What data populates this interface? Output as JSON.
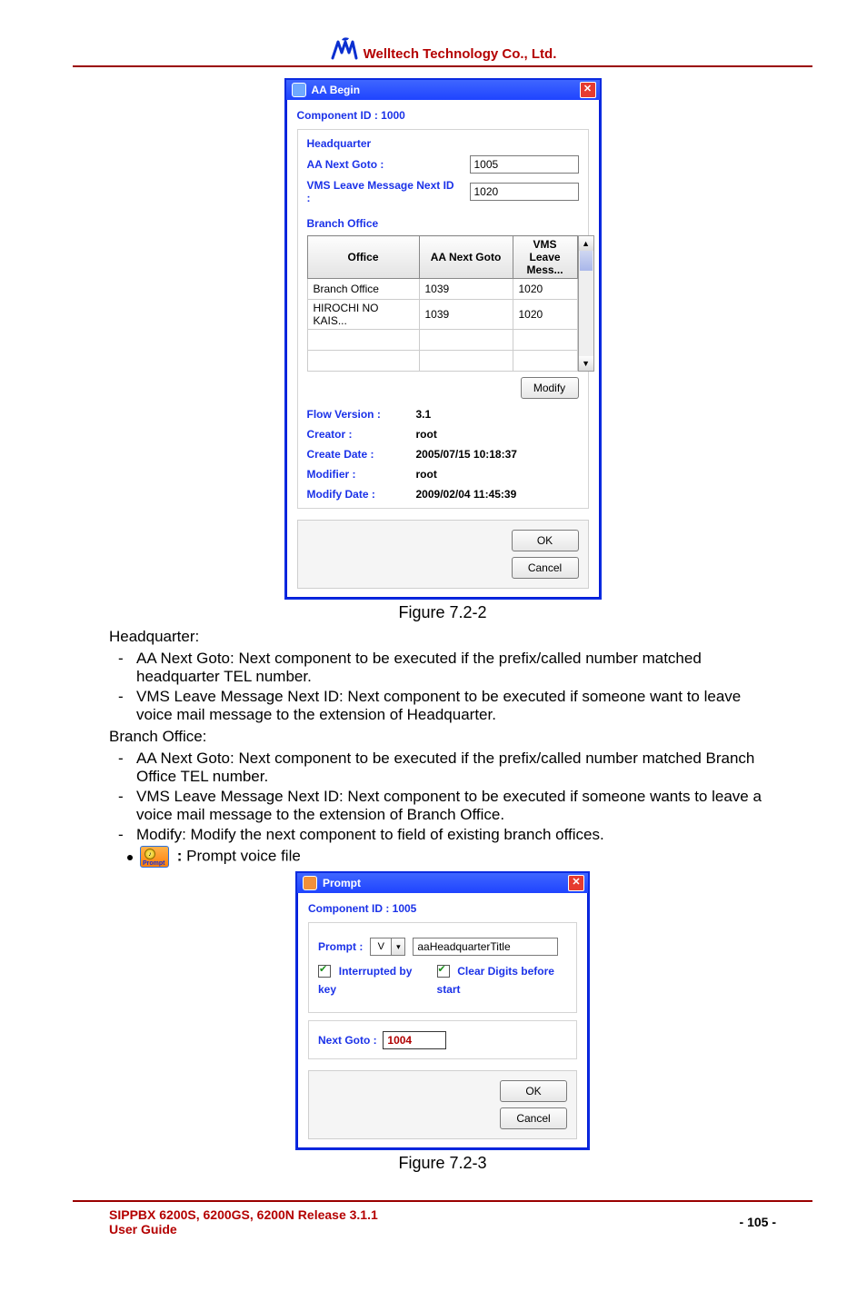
{
  "header": {
    "company": "Welltech Technology Co., Ltd."
  },
  "dialog1": {
    "title": "AA Begin",
    "component_label": "Component ID : 1000",
    "hq_heading": "Headquarter",
    "aa_next_label": "AA Next Goto :",
    "aa_next_value": "1005",
    "vms_next_label": "VMS Leave Message Next ID :",
    "vms_next_value": "1020",
    "branch_heading": "Branch Office",
    "tbl_h_office": "Office",
    "tbl_h_aanext": "AA Next Goto",
    "tbl_h_vms": "VMS Leave Mess...",
    "rows": [
      {
        "office": "Branch Office",
        "aanext": "1039",
        "vms": "1020"
      },
      {
        "office": "HIROCHI NO KAIS...",
        "aanext": "1039",
        "vms": "1020"
      }
    ],
    "modify_btn": "Modify",
    "flow_version_lbl": "Flow Version :",
    "flow_version_val": "3.1",
    "creator_lbl": "Creator :",
    "creator_val": "root",
    "create_date_lbl": "Create Date :",
    "create_date_val": "2005/07/15 10:18:37",
    "modifier_lbl": "Modifier :",
    "modifier_val": "root",
    "modify_date_lbl": "Modify Date :",
    "modify_date_val": "2009/02/04 11:45:39",
    "ok_btn": "OK",
    "cancel_btn": "Cancel"
  },
  "caption1": "Figure 7.2-2",
  "text": {
    "hq_line": "Headquarter:",
    "hq_b1": "AA Next Goto: Next component to be executed if the prefix/called number matched headquarter TEL number.",
    "hq_b2": "VMS Leave Message Next ID: Next component to be executed if someone want to leave voice mail message to the extension of Headquarter.",
    "bo_line": "Branch Office:",
    "bo_b1": "AA Next Goto: Next component to be executed if the prefix/called number matched Branch Office TEL number.",
    "bo_b2": "VMS Leave Message Next ID: Next component to be executed if someone wants to leave a voice mail message to the extension of Branch Office.",
    "bo_b3": "Modify: Modify the next component to field of existing branch offices.",
    "prompt_colon": ":",
    "prompt_desc": " Prompt voice file"
  },
  "dialog2": {
    "title": "Prompt",
    "component_label": "Component ID : 1005",
    "prompt_lbl": "Prompt :",
    "prompt_dd_curr": "V",
    "prompt_value": "aaHeadquarterTitle",
    "chk1_lbl": "Interrupted by key",
    "chk2_lbl": "Clear Digits before start",
    "next_goto_lbl": "Next Goto :",
    "next_goto_val": "1004",
    "ok_btn": "OK",
    "cancel_btn": "Cancel"
  },
  "caption2": "Figure 7.2-3",
  "footer": {
    "left1": "SIPPBX 6200S, 6200GS, 6200N Release 3.1.1",
    "left2": "User Guide",
    "page": "- 105 -"
  }
}
